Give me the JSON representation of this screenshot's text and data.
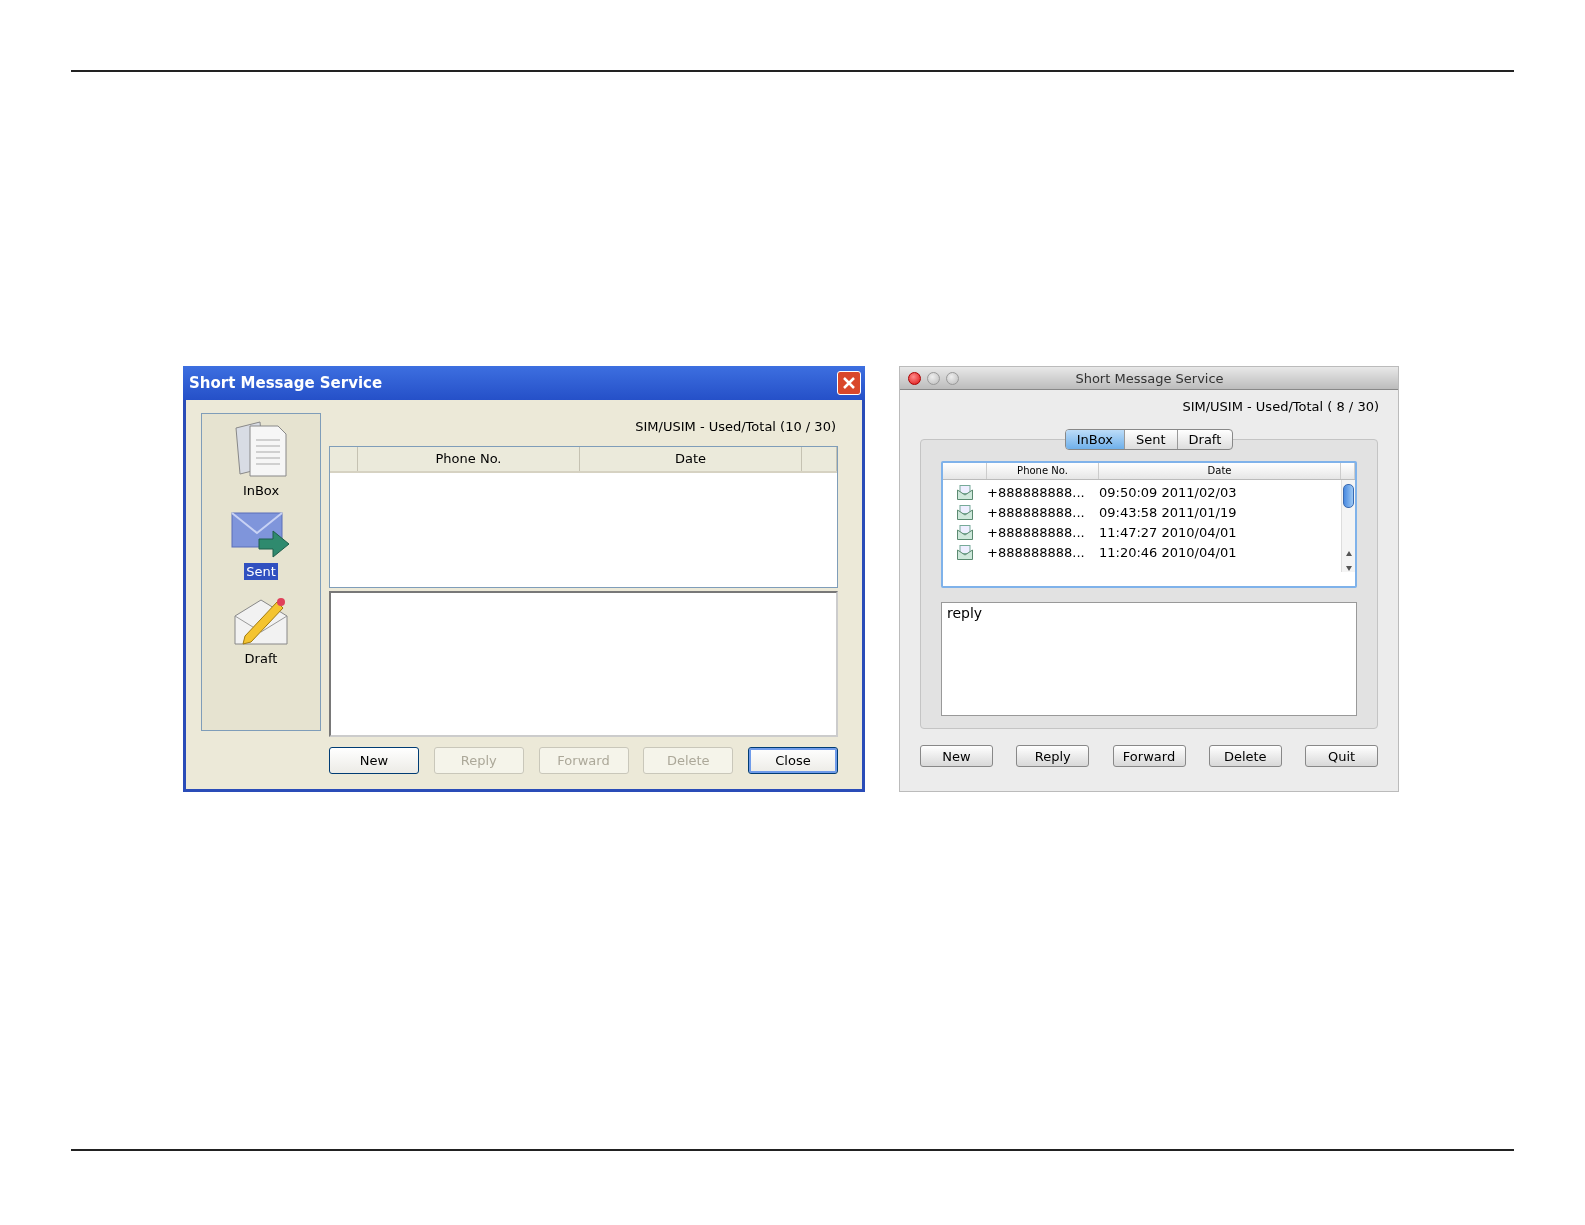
{
  "xp_window": {
    "title": "Short Message Service",
    "sidebar": [
      {
        "label": "InBox",
        "kind": "inbox",
        "selected": false
      },
      {
        "label": "Sent",
        "kind": "sent",
        "selected": true
      },
      {
        "label": "Draft",
        "kind": "draft",
        "selected": false
      }
    ],
    "storage": "SIM/USIM - Used/Total (10 / 30)",
    "columns": [
      "Phone No.",
      "Date"
    ],
    "buttons": [
      {
        "label": "New",
        "disabled": false,
        "default": false
      },
      {
        "label": "Reply",
        "disabled": true,
        "default": false
      },
      {
        "label": "Forward",
        "disabled": true,
        "default": false
      },
      {
        "label": "Delete",
        "disabled": true,
        "default": false
      },
      {
        "label": "Close",
        "disabled": false,
        "default": true
      }
    ]
  },
  "mac_window": {
    "title": "Short Message Service",
    "storage": "SIM/USIM - Used/Total ( 8 / 30)",
    "tabs": [
      {
        "label": "InBox",
        "selected": true
      },
      {
        "label": "Sent",
        "selected": false
      },
      {
        "label": "Draft",
        "selected": false
      }
    ],
    "columns": [
      "Phone No.",
      "Date"
    ],
    "rows": [
      {
        "phone": "+888888888...",
        "date": "09:50:09 2011/02/03"
      },
      {
        "phone": "+888888888...",
        "date": "09:43:58 2011/01/19"
      },
      {
        "phone": "+888888888...",
        "date": "11:47:27 2010/04/01"
      },
      {
        "phone": "+888888888...",
        "date": "11:20:46 2010/04/01"
      }
    ],
    "message": "reply",
    "buttons": [
      "New",
      "Reply",
      "Forward",
      "Delete",
      "Quit"
    ]
  }
}
